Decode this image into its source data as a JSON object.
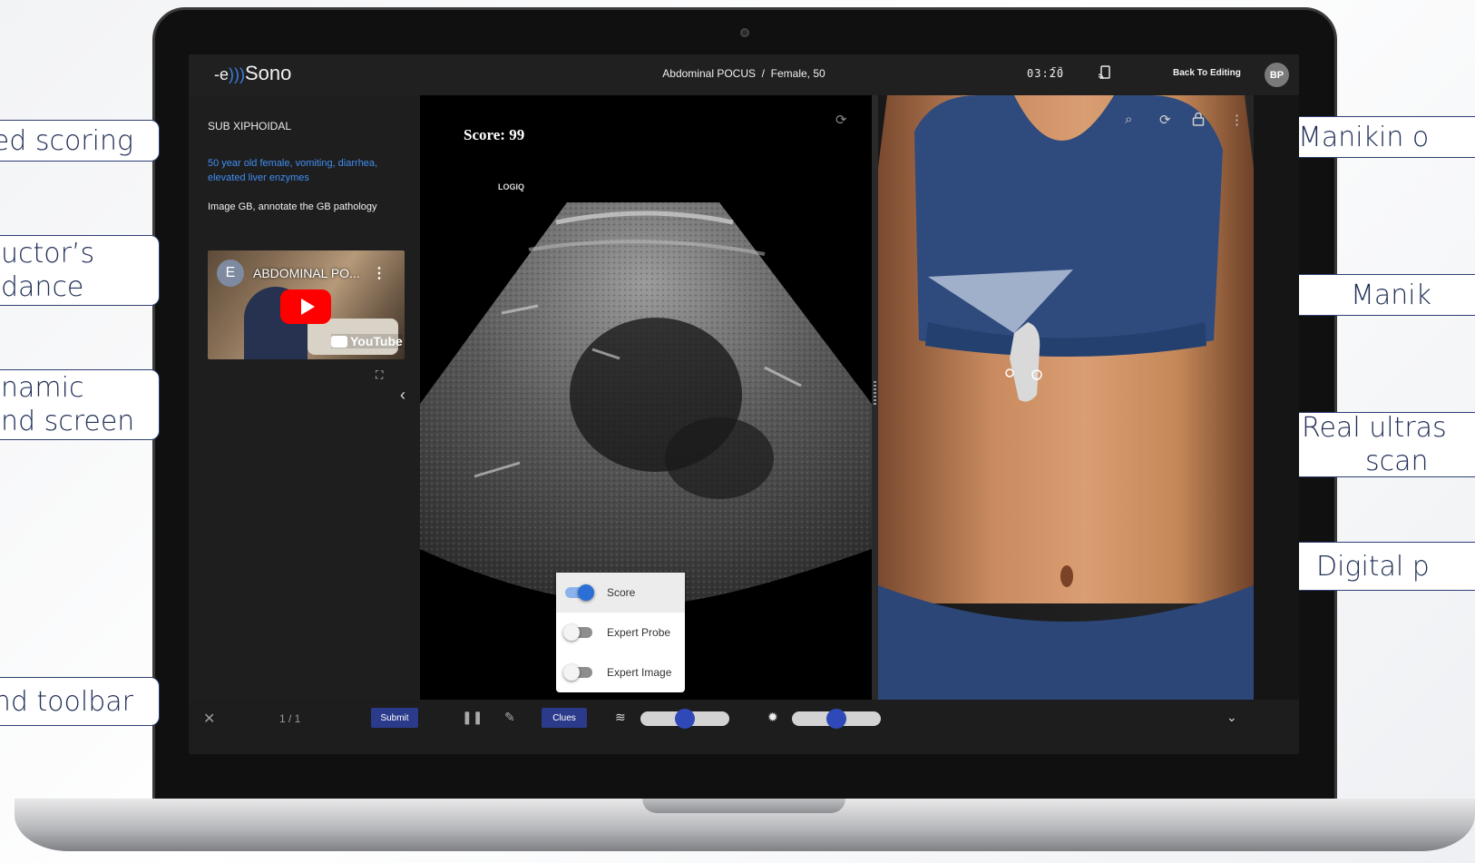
{
  "callouts": {
    "left": [
      {
        "lines": [
          "ed scoring"
        ]
      },
      {
        "lines": [
          "uctor’s",
          "dance"
        ]
      },
      {
        "lines": [
          "namic",
          "nd screen"
        ]
      },
      {
        "lines": [
          "nd toolbar"
        ]
      }
    ],
    "right": [
      {
        "lines": [
          "Manikin o"
        ]
      },
      {
        "lines": [
          "Manik"
        ]
      },
      {
        "lines": [
          "Real ultras",
          "scan"
        ]
      },
      {
        "lines": [
          "Digital p"
        ]
      }
    ]
  },
  "app": {
    "logo_text": "Sono",
    "case_title": "Abdominal POCUS  /  Female, 50",
    "timer": "03:20",
    "back_to_editing": "Back To Editing",
    "avatar_initials": "BP"
  },
  "left_panel": {
    "view_name": "SUB XIPHOIDAL",
    "case_description": "50 year old female, vomiting, diarrhea, elevated liver enzymes",
    "task": "Image GB, annotate the GB  pathology",
    "video": {
      "channel_initial": "E",
      "title": "ABDOMINAL PO...",
      "platform": "YouTube"
    }
  },
  "ultrasound": {
    "score_label": "Score: 99",
    "machine_label": "LOGIQ"
  },
  "settings_menu": [
    {
      "label": "Score",
      "on": true
    },
    {
      "label": "Expert Probe",
      "on": false
    },
    {
      "label": "Expert Image",
      "on": false
    }
  ],
  "toolbar": {
    "page_indicator": "1 / 1",
    "submit_label": "Submit",
    "clues_label": "Clues",
    "gain_level": 0.5,
    "brightness_level": 0.5
  },
  "icons": {
    "close": "close-icon",
    "pause": "pause-icon",
    "pencil": "pencil-icon",
    "gain": "gain-icon",
    "brightness": "sun-icon",
    "chevron": "chevron-down-icon"
  },
  "colors": {
    "accent": "#2b3a8a",
    "link": "#3f8ef2",
    "toggle_on": "#2b6fd6",
    "youtube_red": "#ff0000",
    "callout_border": "#2d3f73"
  }
}
